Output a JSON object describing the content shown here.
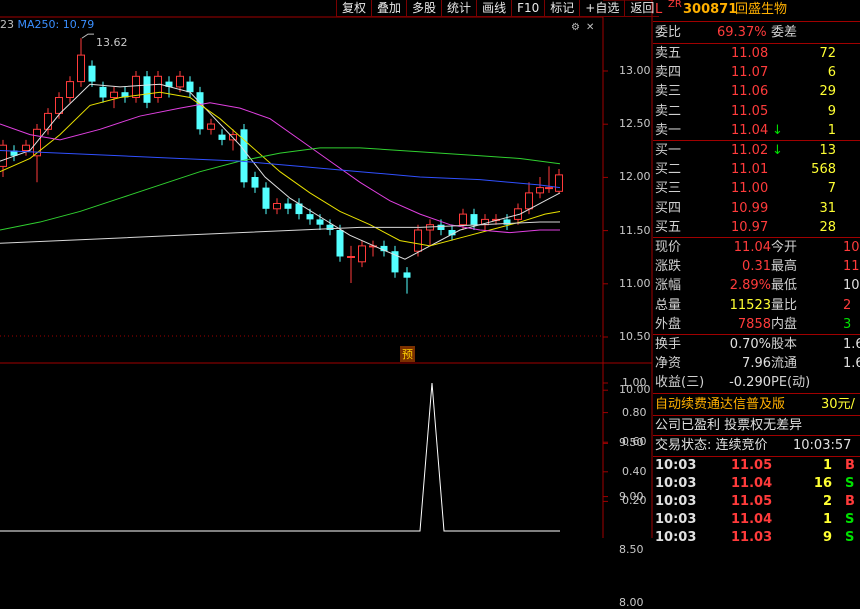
{
  "toolbar": {
    "buttons": [
      "复权",
      "叠加",
      "多股",
      "统计",
      "画线",
      "F10",
      "标记",
      "+自选",
      "返回"
    ]
  },
  "chart_header": {
    "left_partial": "23",
    "ma_label": "MA250: 10.79"
  },
  "price_axis": [
    "13.00",
    "12.50",
    "12.00",
    "11.50",
    "11.00",
    "10.50",
    "10.00",
    "9.50",
    "9.00",
    "8.50",
    "8.00"
  ],
  "peak_label": "13.62",
  "forecast_marker": "预",
  "indicator_axis": [
    "1.00",
    "0.80",
    "0.60",
    "0.40",
    "0.20"
  ],
  "stock": {
    "prefix": "L",
    "badge": "ZR",
    "code": "300871",
    "name": "回盛生物"
  },
  "commission": {
    "label": "委比",
    "ratio": "69.37%",
    "diff_label": "委差"
  },
  "sell_orders": [
    {
      "label": "卖五",
      "price": "11.08",
      "volume": "72",
      "arrow": ""
    },
    {
      "label": "卖四",
      "price": "11.07",
      "volume": "6",
      "arrow": ""
    },
    {
      "label": "卖三",
      "price": "11.06",
      "volume": "29",
      "arrow": ""
    },
    {
      "label": "卖二",
      "price": "11.05",
      "volume": "9",
      "arrow": ""
    },
    {
      "label": "卖一",
      "price": "11.04",
      "volume": "1",
      "arrow": "↓"
    }
  ],
  "buy_orders": [
    {
      "label": "买一",
      "price": "11.02",
      "volume": "13",
      "arrow": "↓"
    },
    {
      "label": "买二",
      "price": "11.01",
      "volume": "568",
      "arrow": ""
    },
    {
      "label": "买三",
      "price": "11.00",
      "volume": "7",
      "arrow": ""
    },
    {
      "label": "买四",
      "price": "10.99",
      "volume": "31",
      "arrow": ""
    },
    {
      "label": "买五",
      "price": "10.97",
      "volume": "28",
      "arrow": ""
    }
  ],
  "quote_stats": [
    {
      "l1": "现价",
      "v1": "11.04",
      "l2": "今开",
      "v2": "10",
      "c1": "red",
      "c2": "red"
    },
    {
      "l1": "涨跌",
      "v1": "0.31",
      "l2": "最高",
      "v2": "11",
      "c1": "red",
      "c2": "red"
    },
    {
      "l1": "涨幅",
      "v1": "2.89%",
      "l2": "最低",
      "v2": "10",
      "c1": "red",
      "c2": "white"
    },
    {
      "l1": "总量",
      "v1": "11523",
      "l2": "量比",
      "v2": "2",
      "c1": "yellow",
      "c2": "red"
    },
    {
      "l1": "外盘",
      "v1": "7858",
      "l2": "内盘",
      "v2": "3",
      "c1": "red",
      "c2": "green"
    }
  ],
  "fundamentals": [
    {
      "l1": "换手",
      "v1": "0.70%",
      "l2": "股本",
      "v2": "1.6"
    },
    {
      "l1": "净资",
      "v1": "7.96",
      "l2": "流通",
      "v2": "1.6"
    },
    {
      "l1": "收益(三)",
      "v1": "-0.290",
      "l2": "PE(动)",
      "v2": ""
    }
  ],
  "promo": {
    "text": "自动续费通达信普及版",
    "price": "30元/"
  },
  "company_note": "公司已盈利 投票权无差异",
  "trade_status": {
    "label": "交易状态: 连续竞价",
    "time": "10:03:57"
  },
  "ticks": [
    {
      "time": "10:03",
      "price": "11.05",
      "vol": "1",
      "side": "B"
    },
    {
      "time": "10:03",
      "price": "11.04",
      "vol": "16",
      "side": "S"
    },
    {
      "time": "10:03",
      "price": "11.05",
      "vol": "2",
      "side": "B"
    },
    {
      "time": "10:03",
      "price": "11.04",
      "vol": "1",
      "side": "S"
    },
    {
      "time": "10:03",
      "price": "11.03",
      "vol": "9",
      "side": "S"
    }
  ],
  "colors": {
    "up": "#ff3b3b",
    "down": "#54ffff",
    "grid": "#a00000",
    "ma_white": "#e0e0e0",
    "ma_yellow": "#e8e000",
    "ma_magenta": "#e040e0",
    "ma_green": "#30d030",
    "ma_blue": "#3050ff"
  }
}
